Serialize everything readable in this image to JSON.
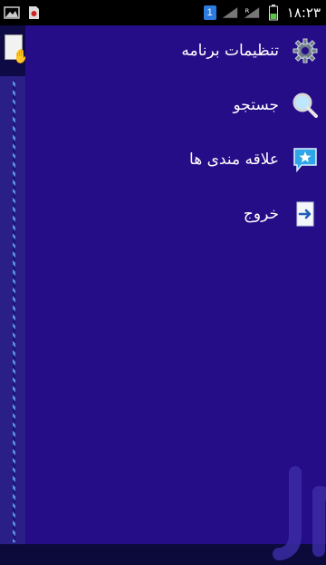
{
  "status_bar": {
    "time": "۱۸:۲۳",
    "notification_badge": "1",
    "left_icons": [
      "image-icon",
      "sd-card-icon"
    ],
    "right_icons": [
      "wifi-signal-icon",
      "roaming-signal-icon",
      "battery-icon"
    ]
  },
  "drawer": {
    "background_color": "#250d88",
    "items": [
      {
        "label": "تنظیمات برنامه",
        "icon": "gear-icon"
      },
      {
        "label": "جستجو",
        "icon": "search-icon"
      },
      {
        "label": "علاقه مندی ها",
        "icon": "star-message-icon"
      },
      {
        "label": "خروج",
        "icon": "exit-arrow-icon"
      }
    ]
  },
  "colors": {
    "status_bar": "#000000",
    "drawer_bg": "#250d88",
    "text": "#ffffff"
  }
}
